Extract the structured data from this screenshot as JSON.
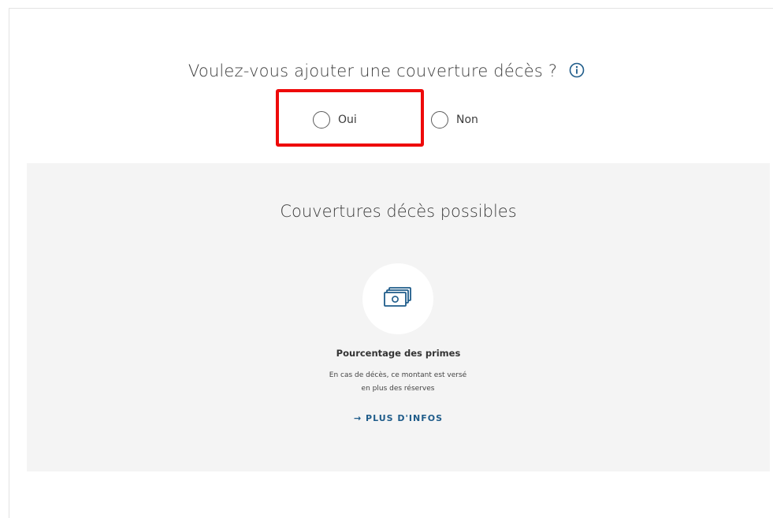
{
  "question": {
    "text": "Voulez-vous ajouter une couverture décès ?",
    "info_icon": "info-circle-icon"
  },
  "options": [
    {
      "label": "Oui",
      "selected": false
    },
    {
      "label": "Non",
      "selected": false
    }
  ],
  "colors": {
    "highlight": "#ee0a0a",
    "accent": "#1f5c8a",
    "panel_bg": "#f4f4f4"
  },
  "panel": {
    "title": "Couvertures décès possibles",
    "card": {
      "icon": "banknotes-icon",
      "title": "Pourcentage des primes",
      "description_line1": "En cas de décès, ce montant est versé",
      "description_line2": "en plus des réserves",
      "link_label": "→ PLUS D'INFOS"
    }
  }
}
